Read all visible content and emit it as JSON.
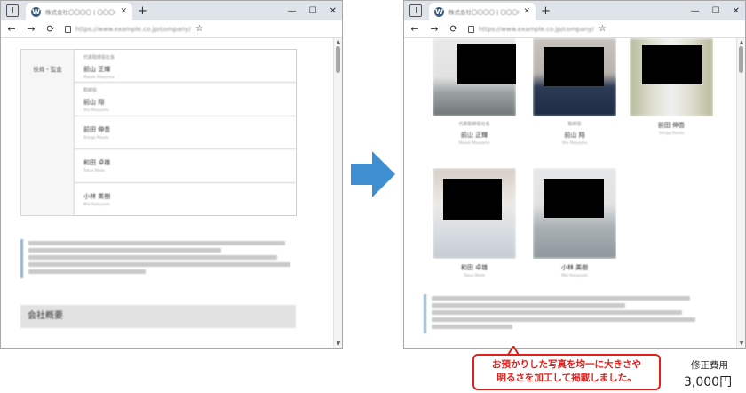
{
  "browser": {
    "tab_title": "株式会社〇〇〇〇 | 〇〇〇〇",
    "favicon": "W",
    "url": "https://www.example.co.jp/company/",
    "controls": {
      "minimize": "—",
      "maximize": "☐",
      "close": "✕"
    },
    "nav": {
      "back": "←",
      "forward": "→",
      "reload": "⟳",
      "new_tab": "+",
      "favorites": "☆"
    }
  },
  "before": {
    "table_header": "役員・監査",
    "members": [
      {
        "role": "代表取締役社長",
        "name": "前山 正輝",
        "sub": "Masaki Maeyama"
      },
      {
        "role": "取締役",
        "name": "前山 翔",
        "sub": "Sho Maeyama"
      },
      {
        "role": "",
        "name": "前田 伸吾",
        "sub": "Shingo Maeda"
      },
      {
        "role": "",
        "name": "和田 卓雄",
        "sub": "Takuo Wada"
      },
      {
        "role": "",
        "name": "小林 美樹",
        "sub": "Miki Kobayashi"
      }
    ],
    "company_heading": "会社概要"
  },
  "after": {
    "cards": [
      {
        "role": "代表取締役社長",
        "name": "前山 正輝",
        "sub": "Masaki Maeyama"
      },
      {
        "role": "取締役",
        "name": "前山 翔",
        "sub": "Sho Maeyama"
      },
      {
        "role": "",
        "name": "前田 伸吾",
        "sub": "Shingo Maeda"
      },
      {
        "role": "",
        "name": "和田 卓雄",
        "sub": "Takuo Wada"
      },
      {
        "role": "",
        "name": "小林 美樹",
        "sub": "Miki Kobayashi"
      }
    ]
  },
  "callout": {
    "line1": "お預かりした写真を均一に大きさや",
    "line2": "明るさを加工して掲載しました。"
  },
  "fee": {
    "label": "修正費用",
    "value": "3,000円"
  },
  "colors": {
    "accent_red": "#e0201b",
    "arrow_blue": "#3f8ed1",
    "note_bar": "#8fb1c9"
  }
}
